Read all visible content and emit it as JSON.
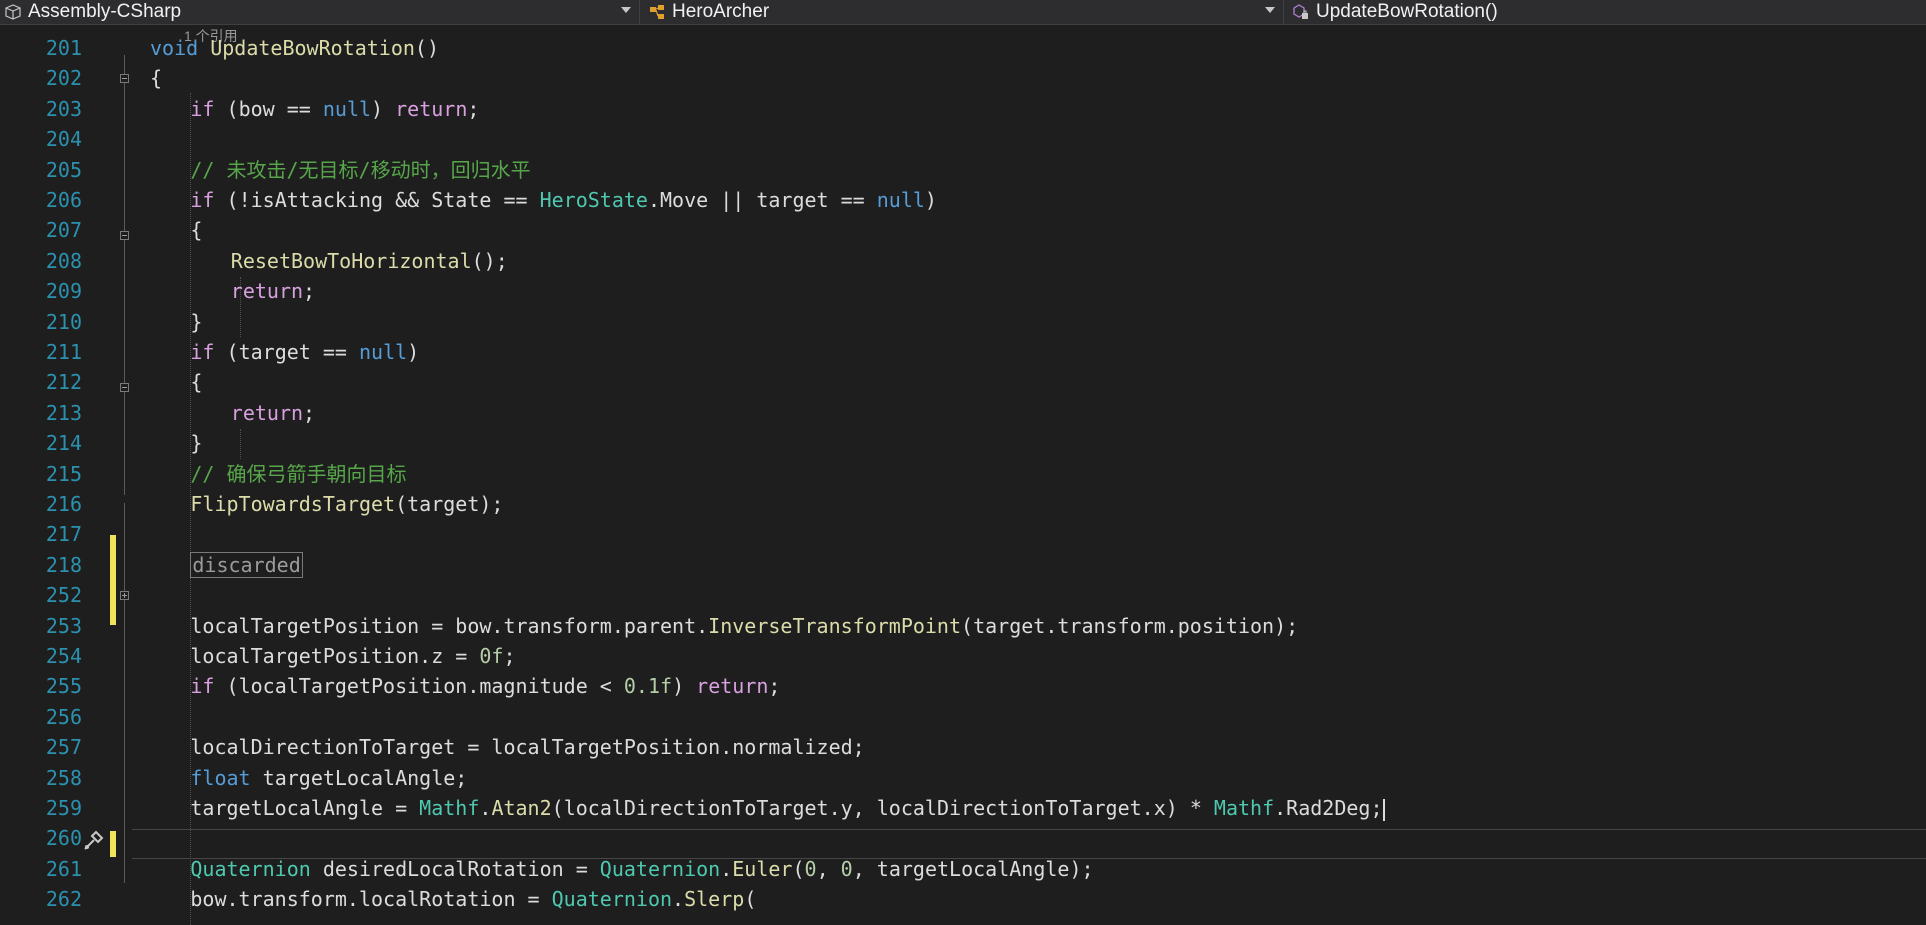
{
  "navbar": {
    "project": "Assembly-CSharp",
    "class": "HeroArcher",
    "member": "UpdateBowRotation()"
  },
  "editor": {
    "reference_hint": "1 个引用",
    "collapsed_region_label": "discarded",
    "line_numbers": [
      "201",
      "202",
      "203",
      "204",
      "205",
      "206",
      "207",
      "208",
      "209",
      "210",
      "211",
      "212",
      "213",
      "214",
      "215",
      "216",
      "217",
      "218",
      "252",
      "253",
      "254",
      "255",
      "256",
      "257",
      "258",
      "259",
      "260",
      "261",
      "262"
    ],
    "lines": [
      [
        [
          "kw",
          "void"
        ],
        [
          "t",
          " "
        ],
        [
          "mth",
          "UpdateBowRotation"
        ],
        [
          "t",
          "()"
        ]
      ],
      [
        [
          "t",
          "{"
        ]
      ],
      [
        [
          "ctl",
          "if"
        ],
        [
          "t",
          " (bow == "
        ],
        [
          "kw",
          "null"
        ],
        [
          "t",
          ") "
        ],
        [
          "ctl",
          "return"
        ],
        [
          "t",
          ";"
        ]
      ],
      [],
      [
        [
          "cmt",
          "// 未攻击/无目标/移动时，回归水平"
        ]
      ],
      [
        [
          "ctl",
          "if"
        ],
        [
          "t",
          " (!isAttacking && State == "
        ],
        [
          "typ",
          "HeroState"
        ],
        [
          "t",
          ".Move || target == "
        ],
        [
          "kw",
          "null"
        ],
        [
          "t",
          ")"
        ]
      ],
      [
        [
          "t",
          "{"
        ]
      ],
      [
        [
          "mth",
          "ResetBowToHorizontal"
        ],
        [
          "t",
          "();"
        ]
      ],
      [
        [
          "ctl",
          "return"
        ],
        [
          "t",
          ";"
        ]
      ],
      [
        [
          "t",
          "}"
        ]
      ],
      [
        [
          "ctl",
          "if"
        ],
        [
          "t",
          " (target == "
        ],
        [
          "kw",
          "null"
        ],
        [
          "t",
          ")"
        ]
      ],
      [
        [
          "t",
          "{"
        ]
      ],
      [
        [
          "ctl",
          "return"
        ],
        [
          "t",
          ";"
        ]
      ],
      [
        [
          "t",
          "}"
        ]
      ],
      [
        [
          "cmt",
          "// 确保弓箭手朝向目标"
        ]
      ],
      [
        [
          "mth",
          "FlipTowardsTarget"
        ],
        [
          "t",
          "(target);"
        ]
      ],
      [],
      [],
      [],
      [
        [
          "t",
          "localTargetPosition = bow.transform.parent."
        ],
        [
          "mth",
          "InverseTransformPoint"
        ],
        [
          "t",
          "(target.transform.position);"
        ]
      ],
      [
        [
          "t",
          "localTargetPosition.z = "
        ],
        [
          "num",
          "0f"
        ],
        [
          "t",
          ";"
        ]
      ],
      [
        [
          "ctl",
          "if"
        ],
        [
          "t",
          " (localTargetPosition.magnitude < "
        ],
        [
          "num",
          "0.1f"
        ],
        [
          "t",
          ") "
        ],
        [
          "ctl",
          "return"
        ],
        [
          "t",
          ";"
        ]
      ],
      [],
      [
        [
          "t",
          "localDirectionToTarget = localTargetPosition.normalized;"
        ]
      ],
      [
        [
          "kw",
          "float"
        ],
        [
          "t",
          " targetLocalAngle;"
        ]
      ],
      [
        [
          "t",
          "targetLocalAngle = "
        ],
        [
          "typ",
          "Mathf"
        ],
        [
          "t",
          "."
        ],
        [
          "mth",
          "Atan2"
        ],
        [
          "t",
          "(localDirectionToTarget.y, localDirectionToTarget.x) * "
        ],
        [
          "typ",
          "Mathf"
        ],
        [
          "t",
          ".Rad2Deg;"
        ]
      ],
      [],
      [
        [
          "typ",
          "Quaternion"
        ],
        [
          "t",
          " desiredLocalRotation = "
        ],
        [
          "typ",
          "Quaternion"
        ],
        [
          "t",
          "."
        ],
        [
          "mth",
          "Euler"
        ],
        [
          "t",
          "("
        ],
        [
          "num",
          "0"
        ],
        [
          "t",
          ", "
        ],
        [
          "num",
          "0"
        ],
        [
          "t",
          ", targetLocalAngle);"
        ]
      ],
      [
        [
          "t",
          "bow.transform.localRotation = "
        ],
        [
          "typ",
          "Quaternion"
        ],
        [
          "t",
          "."
        ],
        [
          "mth",
          "Slerp"
        ],
        [
          "t",
          "("
        ]
      ]
    ]
  },
  "colors": {
    "background": "#1e1e1e",
    "line_number": "#2b91af",
    "keyword": "#569cd6",
    "control_keyword": "#d8a0df",
    "method": "#dcdcaa",
    "type": "#4ec9b0",
    "comment": "#57a64a",
    "number": "#b5cea8",
    "change_marker": "#efe45c"
  },
  "icons": [
    "project-icon",
    "class-icon",
    "method-icon",
    "quick-action-icon"
  ]
}
